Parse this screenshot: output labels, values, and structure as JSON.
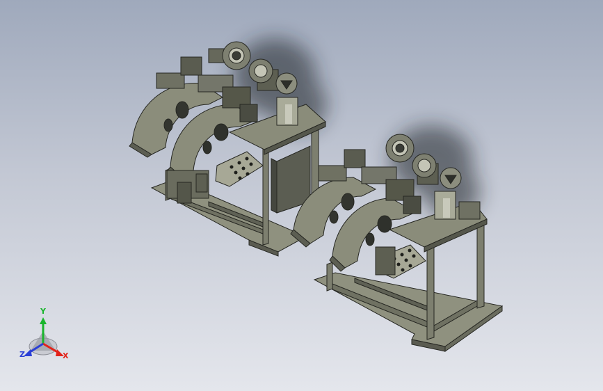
{
  "viewport": {
    "background_top": "#9fa9bc",
    "background_bottom": "#e4e6ec"
  },
  "model": {
    "body_color": "#868877",
    "dark_color": "#3a3c36",
    "shadow_color": "#1f2026"
  },
  "triad": {
    "y_label": "Y",
    "x_label": "X",
    "z_label": "Z",
    "y_color": "#19b52c",
    "x_color": "#e2231a",
    "z_color": "#2b3fd6"
  }
}
